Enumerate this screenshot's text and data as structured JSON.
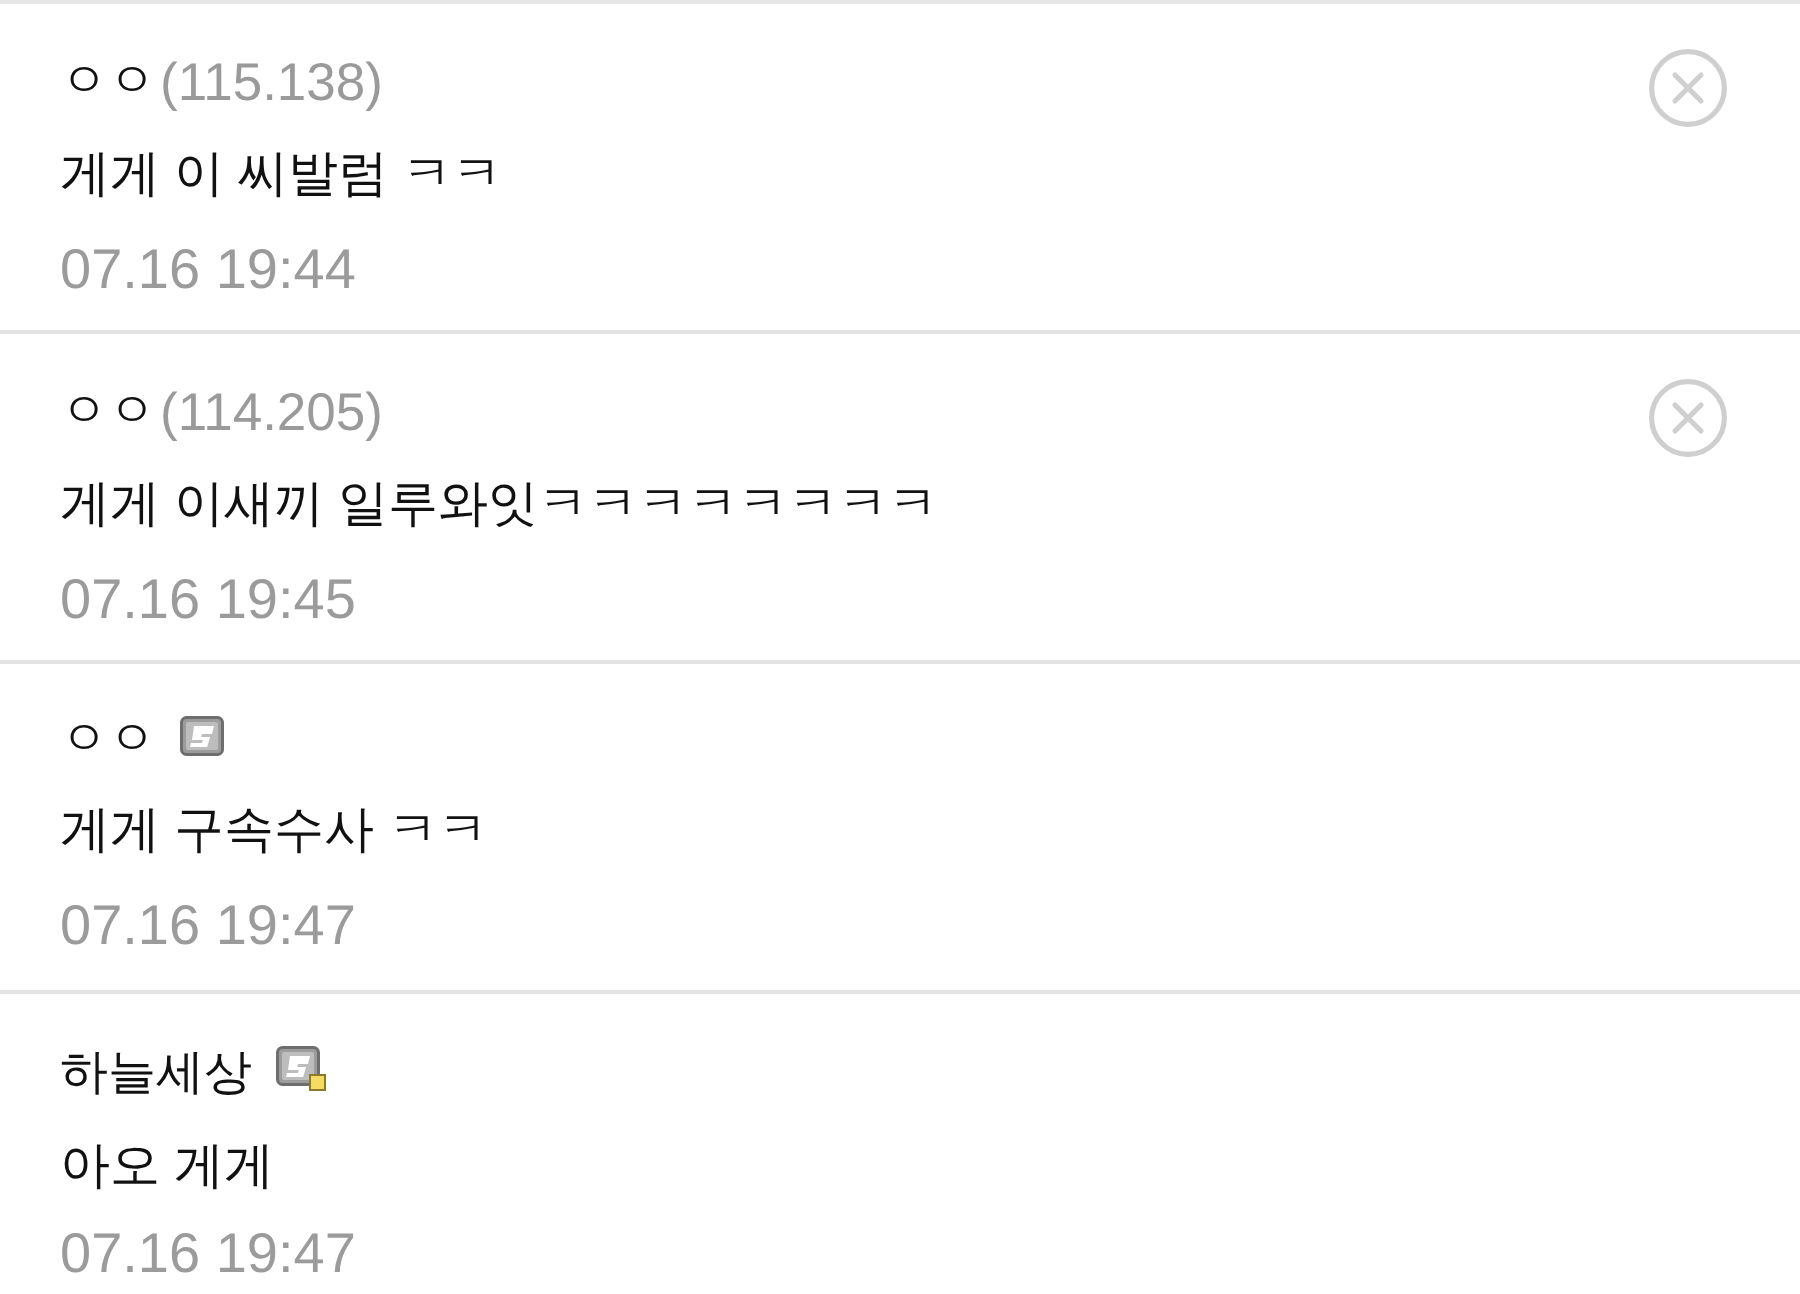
{
  "comments": [
    {
      "kind": "guest",
      "author": "ㅇㅇ",
      "ip": "(115.138)",
      "text": "게게 이 씨발럼 ㅋㅋ",
      "time": "07.16 19:44"
    },
    {
      "kind": "guest",
      "author": "ㅇㅇ",
      "ip": "(114.205)",
      "text": "게게 이새끼 일루와잇ㅋㅋㅋㅋㅋㅋㅋㅋ",
      "time": "07.16 19:45"
    },
    {
      "kind": "fixed_member",
      "author": "ㅇㅇ",
      "text": "게게 구속수사 ㅋㅋ",
      "time": "07.16 19:47"
    },
    {
      "kind": "semi_fixed_member",
      "author": "하늘세상",
      "text": "아오 게게",
      "time": "07.16 19:47"
    }
  ]
}
